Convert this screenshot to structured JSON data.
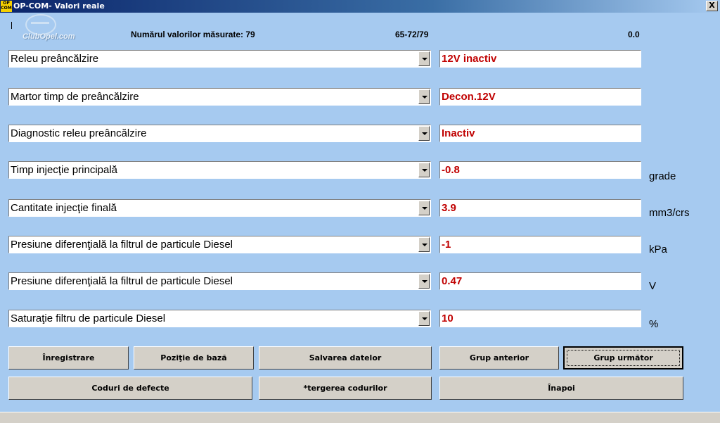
{
  "window": {
    "title": "OP-COM- Valori reale",
    "icon_text": "OP COM",
    "close_label": "X"
  },
  "logo": {
    "text": "ClubOpel.com"
  },
  "info": {
    "count_label": "Numărul valorilor măsurate: 79",
    "range": "65-72/79",
    "value": "0.0"
  },
  "rows": [
    {
      "param": "Releu preâncălzire",
      "value": "12V inactiv",
      "unit": ""
    },
    {
      "param": "Martor timp de preâncălzire",
      "value": "Decon.12V",
      "unit": ""
    },
    {
      "param": "Diagnostic releu preâncălzire",
      "value": "Inactiv",
      "unit": ""
    },
    {
      "param": "Timp injecţie principală",
      "value": "-0.8",
      "unit": "grade"
    },
    {
      "param": "Cantitate injecţie finală",
      "value": "3.9",
      "unit": "mm3/crs"
    },
    {
      "param": "Presiune diferenţială la filtrul de particule Diesel",
      "value": "-1",
      "unit": "kPa"
    },
    {
      "param": "Presiune diferenţială la filtrul de particule Diesel",
      "value": "0.47",
      "unit": "V"
    },
    {
      "param": "Saturaţie filtru de particule Diesel",
      "value": "10",
      "unit": "%"
    }
  ],
  "buttons": {
    "record": "Înregistrare",
    "base_position": "Poziţie de bază",
    "save_data": "Salvarea datelor",
    "prev_group": "Grup anterior",
    "next_group": "Grup următor",
    "fault_codes": "Coduri de defecte",
    "clear_codes": "*tergerea codurilor",
    "back": "Înapoi"
  },
  "colors": {
    "background": "#a6caf0",
    "value_text": "#c00000",
    "button_face": "#d4d0c8"
  }
}
